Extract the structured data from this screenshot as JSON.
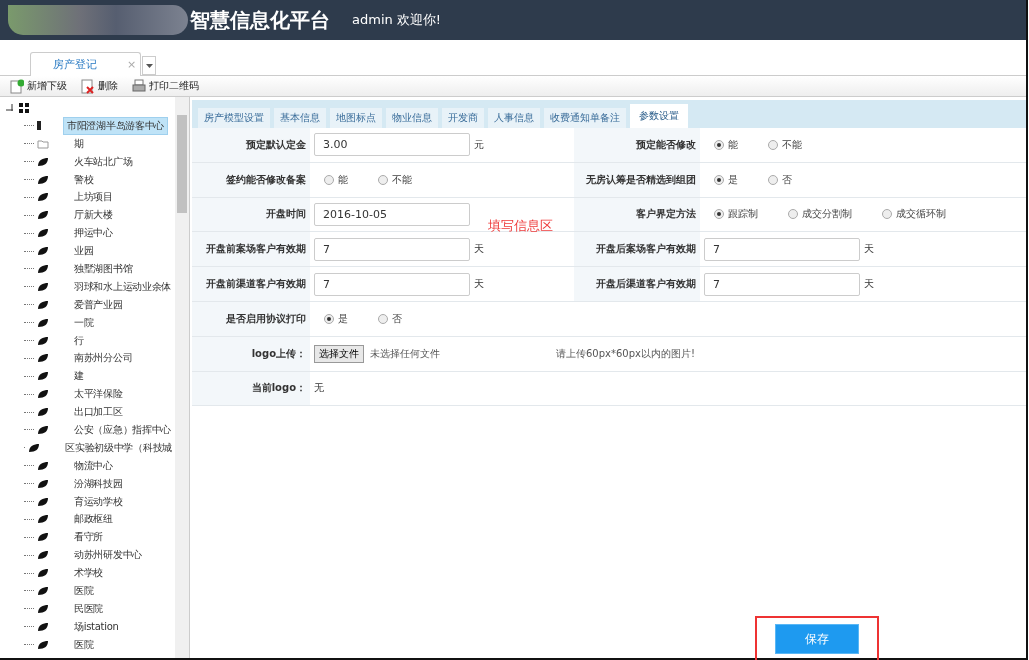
{
  "header": {
    "title": "智慧信息化平台",
    "greeting": "admin 欢迎你!"
  },
  "page_tabs": [
    {
      "label": "房产登记",
      "selected": true,
      "close": "×"
    }
  ],
  "toolbar": [
    {
      "kind": "add",
      "label": "新增下级"
    },
    {
      "kind": "delete",
      "label": "删除"
    },
    {
      "kind": "print",
      "label": "打印二维码"
    }
  ],
  "tree": {
    "expanded": true,
    "children": [
      {
        "label": "市阳澄湖半岛游客中心",
        "selected": true,
        "kind": "node"
      },
      {
        "label": "期",
        "selected": false,
        "kind": "folder"
      },
      {
        "label": "火车站北广场",
        "selected": false,
        "kind": "leaf"
      },
      {
        "label": "警校",
        "selected": false,
        "kind": "leaf"
      },
      {
        "label": "上坊项目",
        "selected": false,
        "kind": "leaf"
      },
      {
        "label": "厅新大楼",
        "selected": false,
        "kind": "leaf"
      },
      {
        "label": "押运中心",
        "selected": false,
        "kind": "leaf"
      },
      {
        "label": "业园",
        "selected": false,
        "kind": "leaf"
      },
      {
        "label": "独墅湖图书馆",
        "selected": false,
        "kind": "leaf"
      },
      {
        "label": "羽球和水上运动业余体",
        "selected": false,
        "kind": "leaf"
      },
      {
        "label": "爱普产业园",
        "selected": false,
        "kind": "leaf"
      },
      {
        "label": "一院",
        "selected": false,
        "kind": "leaf"
      },
      {
        "label": "行",
        "selected": false,
        "kind": "leaf"
      },
      {
        "label": "南苏州分公司",
        "selected": false,
        "kind": "leaf"
      },
      {
        "label": "建",
        "selected": false,
        "kind": "leaf"
      },
      {
        "label": "太平洋保险",
        "selected": false,
        "kind": "leaf"
      },
      {
        "label": "出口加工区",
        "selected": false,
        "kind": "leaf"
      },
      {
        "label": "公安（应急）指挥中心",
        "selected": false,
        "kind": "leaf"
      },
      {
        "label": "区实验初级中学（科技城",
        "selected": false,
        "kind": "leaf"
      },
      {
        "label": "物流中心",
        "selected": false,
        "kind": "leaf"
      },
      {
        "label": "汾湖科技园",
        "selected": false,
        "kind": "leaf"
      },
      {
        "label": "育运动学校",
        "selected": false,
        "kind": "leaf"
      },
      {
        "label": "邮政枢纽",
        "selected": false,
        "kind": "leaf"
      },
      {
        "label": "看守所",
        "selected": false,
        "kind": "leaf"
      },
      {
        "label": "动苏州研发中心",
        "selected": false,
        "kind": "leaf"
      },
      {
        "label": "术学校",
        "selected": false,
        "kind": "leaf"
      },
      {
        "label": "医院",
        "selected": false,
        "kind": "leaf"
      },
      {
        "label": "民医院",
        "selected": false,
        "kind": "leaf"
      },
      {
        "label": "场istation",
        "selected": false,
        "kind": "leaf"
      },
      {
        "label": "医院",
        "selected": false,
        "kind": "leaf"
      }
    ]
  },
  "form_tabs": [
    {
      "label": "房产模型设置",
      "selected": false
    },
    {
      "label": "基本信息",
      "selected": false
    },
    {
      "label": "地图标点",
      "selected": false
    },
    {
      "label": "物业信息",
      "selected": false
    },
    {
      "label": "开发商",
      "selected": false
    },
    {
      "label": "人事信息",
      "selected": false
    },
    {
      "label": "收费通知单备注",
      "selected": false
    },
    {
      "label": "参数设置",
      "selected": true
    }
  ],
  "form_rows": [
    {
      "fields": [
        {
          "kind": "input",
          "label": "预定默认定金",
          "value": "3.00",
          "unit": "元"
        },
        {
          "kind": "radio",
          "label": "预定能否修改",
          "options": [
            {
              "label": "能",
              "selected": true
            },
            {
              "label": "不能",
              "selected": false
            }
          ]
        }
      ]
    },
    {
      "fields": [
        {
          "kind": "radio",
          "label": "签约能否修改备案",
          "options": [
            {
              "label": "能",
              "selected": false
            },
            {
              "label": "不能",
              "selected": false
            }
          ]
        },
        {
          "kind": "radio",
          "label": "无房认筹是否精选到组团",
          "options": [
            {
              "label": "是",
              "selected": true
            },
            {
              "label": "否",
              "selected": false
            }
          ]
        }
      ]
    },
    {
      "fields": [
        {
          "kind": "input",
          "label": "开盘时间",
          "value": "2016-10-05"
        },
        {
          "kind": "radio",
          "label": "客户界定方法",
          "options": [
            {
              "label": "跟踪制",
              "selected": true
            },
            {
              "label": "成交分割制",
              "selected": false
            },
            {
              "label": "成交循环制",
              "selected": false
            }
          ]
        }
      ]
    },
    {
      "fields": [
        {
          "kind": "input",
          "label": "开盘前案场客户有效期",
          "value": "7",
          "unit": "天"
        },
        {
          "kind": "input",
          "label": "开盘后案场客户有效期",
          "value": "7",
          "unit": "天"
        }
      ]
    },
    {
      "fields": [
        {
          "kind": "input",
          "label": "开盘前渠道客户有效期",
          "value": "7",
          "unit": "天"
        },
        {
          "kind": "input",
          "label": "开盘后渠道客户有效期",
          "value": "7",
          "unit": "天"
        }
      ]
    },
    {
      "fields": [
        {
          "kind": "radio",
          "label": "是否启用协议打印",
          "options": [
            {
              "label": "是",
              "selected": true
            },
            {
              "label": "否",
              "selected": false
            }
          ]
        }
      ]
    },
    {
      "fields": [
        {
          "kind": "file",
          "label": "logo上传：",
          "button": "选择文件",
          "status": "未选择任何文件",
          "hint": "请上传60px*60px以内的图片!"
        }
      ]
    },
    {
      "fields": [
        {
          "kind": "text",
          "label": "当前logo：",
          "value": "无"
        }
      ]
    }
  ],
  "annotation": "填写信息区",
  "save_button": "保存"
}
